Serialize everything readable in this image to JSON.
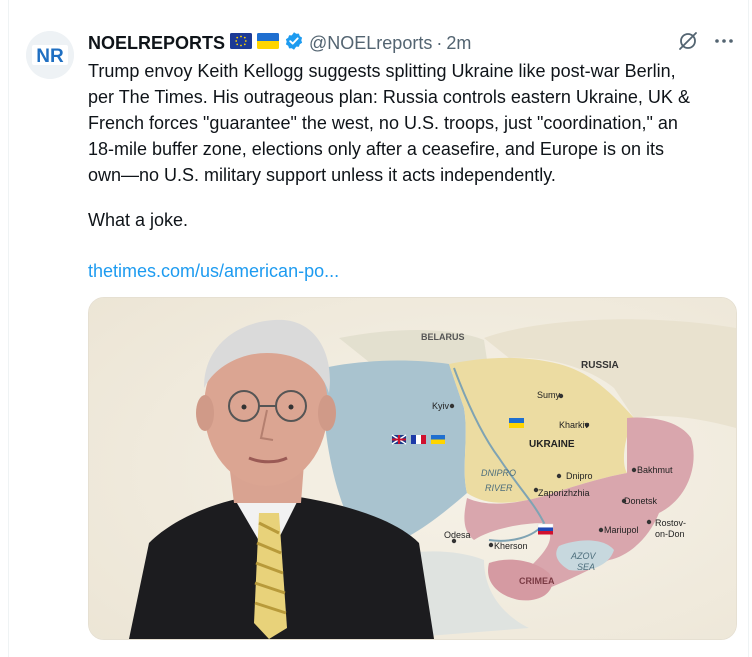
{
  "tweet": {
    "avatar_text": "NR",
    "display_name": "NOELREPORTS",
    "handle": "@NOELreports",
    "separator": "·",
    "time": "2m",
    "text_lines": [
      "Trump envoy Keith Kellogg suggests splitting Ukraine like post-war Berlin,",
      "per The Times. His outrageous plan: Russia controls eastern Ukraine, UK &",
      "French forces \"guarantee\" the west, no U.S. troops, just \"coordination,\" an",
      "18-mile buffer zone, elections only after a ceasefire, and Europe is on its",
      "own—no U.S. military support unless it acts independently."
    ],
    "followup": "What a joke.",
    "link": "thetimes.com/us/american-po...",
    "colors": {
      "link": "#1d9bf0",
      "verified": "#1d9bf0",
      "brand": "#1f6fc2"
    }
  },
  "map": {
    "labels": {
      "belarus": "BELARUS",
      "russia": "RUSSIA",
      "kyiv": "Kyiv",
      "sumy": "Sumy",
      "kharkiv": "Kharkiv",
      "ukraine": "UKRAINE",
      "dnipro": "Dnipro",
      "bakhmut": "Bakhmut",
      "river1": "DNIPRO",
      "river2": "RIVER",
      "zaporizhzhia": "Zaporizhzhia",
      "donetsk": "Donetsk",
      "odesa": "Odesa",
      "mariupol": "Mariupol",
      "rostov1": "Rostov-",
      "rostov2": "on-Don",
      "kherson": "Kherson",
      "azov1": "AZOV",
      "azov2": "SEA",
      "crimea": "CRIMEA"
    }
  }
}
